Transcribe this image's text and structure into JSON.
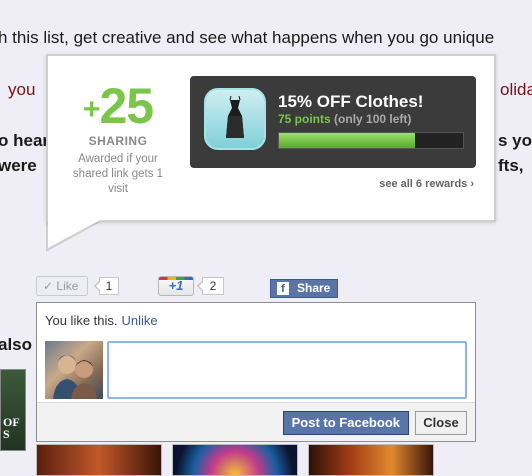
{
  "background": {
    "line1": "h this list, get creative and see what happens when you go unique",
    "line2_left": "you",
    "line2_right": "olida",
    "line3_left": "o hear",
    "line3_right": "s yo",
    "line4_left": "were",
    "line4_right": "fts,",
    "also": "also"
  },
  "reward_popup": {
    "points_plus": "+",
    "points_value": "25",
    "category": "SHARING",
    "awarded_text": "Awarded if your shared link gets 1 visit",
    "reward_title": "15% OFF Clothes!",
    "reward_points": "75 points",
    "reward_left": "(only 100 left)",
    "progress_fraction": 0.74,
    "see_all": "see all 6 rewards ›",
    "accent_color": "#7bc54a"
  },
  "social": {
    "like_label": "Like",
    "like_count": "1",
    "plusone_label": "+1",
    "plusone_count": "2",
    "share_label": "Share",
    "share_icon": "f"
  },
  "fb_comment": {
    "you_like": "You like this.",
    "unlike": "Unlike",
    "post_button": "Post to Facebook",
    "close_button": "Close",
    "comment_value": ""
  },
  "colors": {
    "page_bg": "#efeef7",
    "facebook_blue": "#3b5998",
    "reward_card_bg": "#3b3b3b"
  }
}
